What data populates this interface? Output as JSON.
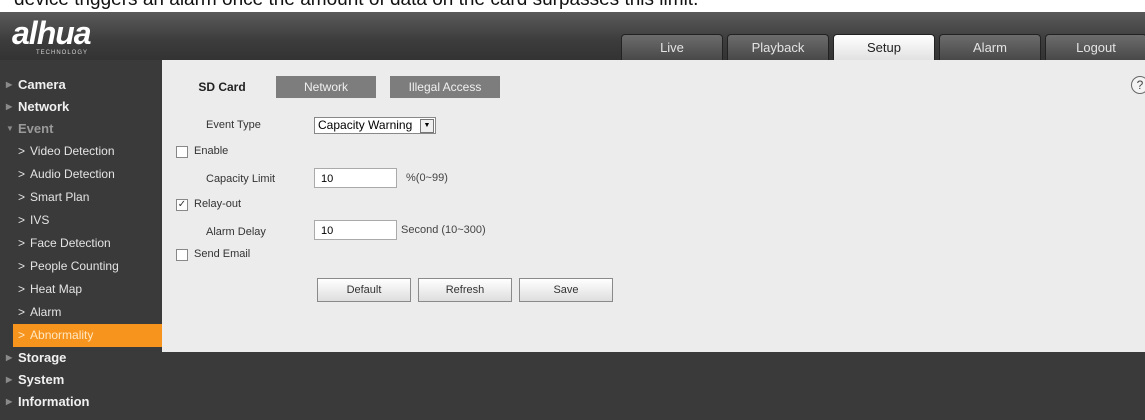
{
  "caption": "device triggers an alarm once the amount of data on the card surpasses this limit.",
  "logo": {
    "text": "alhua",
    "sub": "TECHNOLOGY"
  },
  "nav_tabs": [
    {
      "label": "Live",
      "active": false
    },
    {
      "label": "Playback",
      "active": false
    },
    {
      "label": "Setup",
      "active": true
    },
    {
      "label": "Alarm",
      "active": false
    },
    {
      "label": "Logout",
      "active": false
    }
  ],
  "sidebar": {
    "camera": "Camera",
    "network": "Network",
    "event": "Event",
    "event_items": [
      "Video Detection",
      "Audio Detection",
      "Smart Plan",
      "IVS",
      "Face Detection",
      "People Counting",
      "Heat Map",
      "Alarm",
      "Abnormality"
    ],
    "storage": "Storage",
    "system": "System",
    "information": "Information"
  },
  "sub_tabs": [
    "SD Card",
    "Network",
    "Illegal Access"
  ],
  "form": {
    "event_type_label": "Event Type",
    "event_type_value": "Capacity Warning",
    "enable_label": "Enable",
    "enable_checked": false,
    "capacity_limit_label": "Capacity Limit",
    "capacity_limit_value": "10",
    "capacity_limit_hint": "%(0~99)",
    "relay_out_label": "Relay-out",
    "relay_out_checked": true,
    "alarm_delay_label": "Alarm Delay",
    "alarm_delay_value": "10",
    "alarm_delay_hint": "Second (10~300)",
    "send_email_label": "Send Email",
    "send_email_checked": false
  },
  "buttons": {
    "default": "Default",
    "refresh": "Refresh",
    "save": "Save"
  },
  "help_symbol": "?",
  "colors": {
    "accent": "#f7941d",
    "sidebar_bg": "#3a3a3a",
    "content_bg": "#ececec"
  }
}
